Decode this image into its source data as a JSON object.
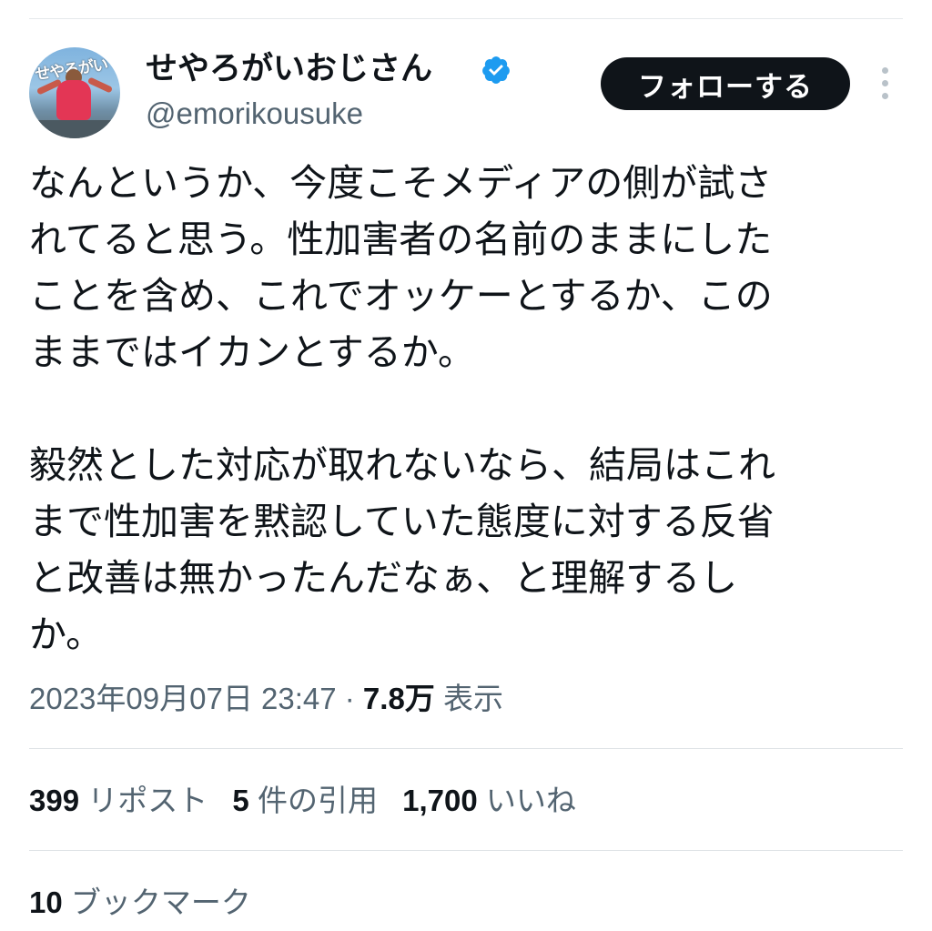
{
  "author": {
    "display_name": "せやろがいおじさん",
    "handle": "@emorikousuke",
    "avatar_sign_text": "せやろがい"
  },
  "follow_label": "フォローする",
  "tweet_text": "なんというか、今度こそメディアの側が試さ\nれてると思う。性加害者の名前のままにした\nことを含め、これでオッケーとするか、この\nままではイカンとするか。\n\n毅然とした対応が取れないなら、結局はこれ\nまで性加害を黙認していた態度に対する反省\nと改善は無かったんだなぁ、と理解するし\nか。",
  "meta": {
    "timestamp": "2023年09月07日 23:47",
    "separator": "·",
    "views_count": "7.8万",
    "views_label": "表示"
  },
  "stats": {
    "reposts": {
      "count": "399",
      "label": "リポスト"
    },
    "quotes": {
      "count": "5",
      "label": "件の引用"
    },
    "likes": {
      "count": "1,700",
      "label": "いいね"
    },
    "bookmarks": {
      "count": "10",
      "label": "ブックマーク"
    }
  },
  "colors": {
    "text_primary": "#0f1419",
    "text_secondary": "#536471",
    "verified_blue": "#1d9bf0",
    "follow_bg": "#0f1419"
  },
  "icons": {
    "verified": "verified-badge-icon",
    "more": "more-options-icon"
  }
}
